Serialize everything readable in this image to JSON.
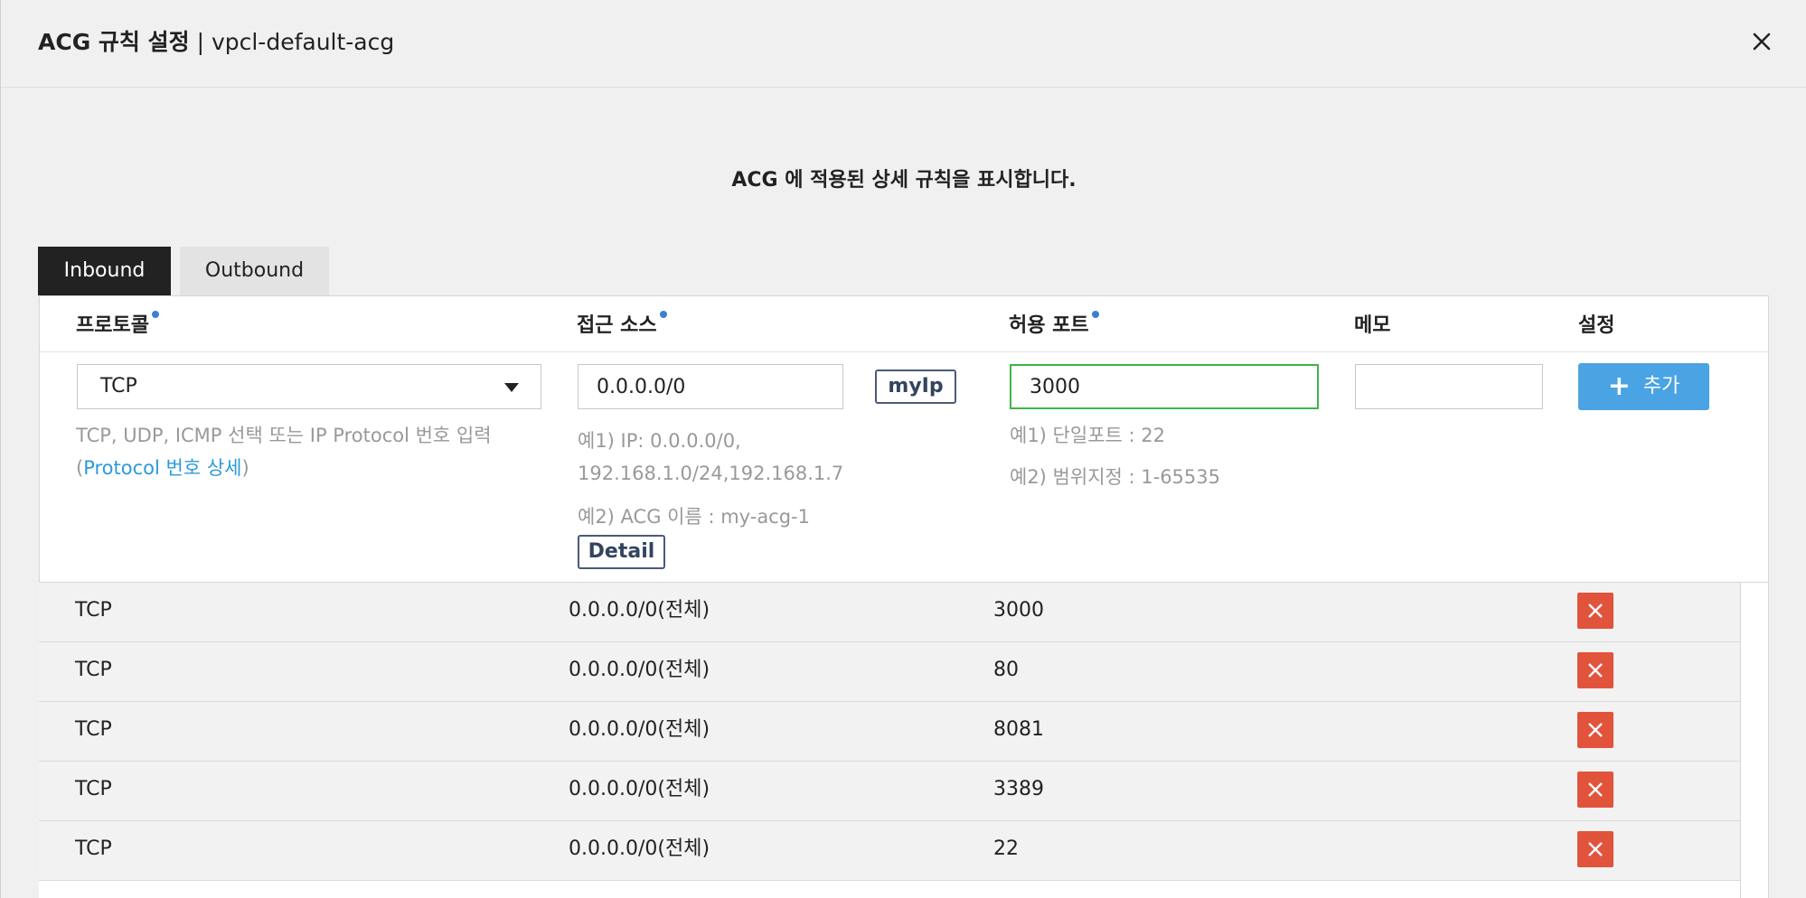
{
  "modal": {
    "title": "ACG 규칙 설정",
    "subtitle": "| vpcl-default-acg",
    "description": "ACG 에 적용된 상세 규칙을 표시합니다."
  },
  "tabs": [
    {
      "label": "Inbound",
      "active": true
    },
    {
      "label": "Outbound",
      "active": false
    }
  ],
  "columns": {
    "protocol": "프로토콜",
    "source": "접근 소스",
    "port": "허용 포트",
    "memo": "메모",
    "settings": "설정"
  },
  "form": {
    "protocol": {
      "selected": "TCP",
      "hint": "TCP, UDP, ICMP 선택 또는 IP Protocol 번호 입력",
      "hint_open": "(",
      "hint_link": "Protocol 번호 상세",
      "hint_close": ")"
    },
    "source": {
      "value": "0.0.0.0/0",
      "myip_label": "myIp",
      "example1_line1": "예1) IP: 0.0.0.0/0,",
      "example1_line2": "192.168.1.0/24,192.168.1.7",
      "example2": "예2) ACG 이름 : my-acg-1",
      "detail_label": "Detail"
    },
    "port": {
      "value": "3000",
      "example1": "예1) 단일포트 : 22",
      "example2": "예2) 범위지정 : 1-65535"
    },
    "memo": {
      "value": ""
    },
    "add_label": "추가"
  },
  "rules": [
    {
      "protocol": "TCP",
      "source": "0.0.0.0/0(전체)",
      "port": "3000"
    },
    {
      "protocol": "TCP",
      "source": "0.0.0.0/0(전체)",
      "port": "80"
    },
    {
      "protocol": "TCP",
      "source": "0.0.0.0/0(전체)",
      "port": "8081"
    },
    {
      "protocol": "TCP",
      "source": "0.0.0.0/0(전체)",
      "port": "3389"
    },
    {
      "protocol": "TCP",
      "source": "0.0.0.0/0(전체)",
      "port": "22"
    }
  ],
  "colors": {
    "tab_active": "#222222",
    "add_button": "#4aa3e3",
    "delete_button": "#e2533b",
    "link": "#2c9ad8",
    "required_dot": "#3a7fd4",
    "active_input_border": "#3cb54a"
  },
  "icons": {
    "close": "close-icon",
    "add": "plus-icon",
    "delete": "close-icon",
    "dropdown": "caret-down-icon"
  }
}
